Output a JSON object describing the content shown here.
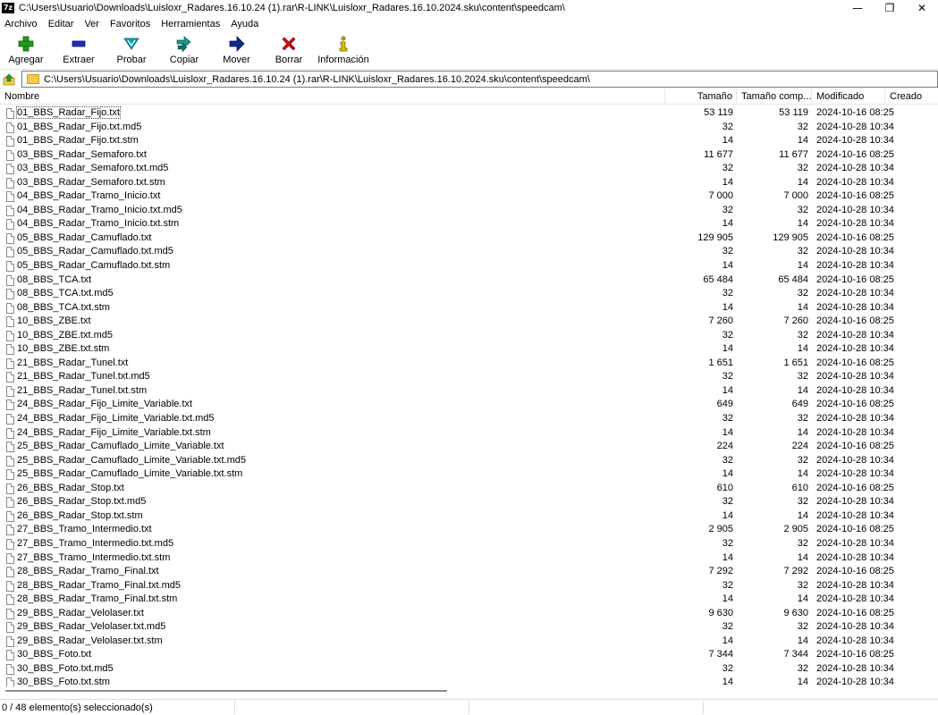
{
  "window": {
    "app_icon": "7z",
    "title": "C:\\Users\\Usuario\\Downloads\\Luisloxr_Radares.16.10.24 (1).rar\\R-LINK\\Luisloxr_Radares.16.10.2024.sku\\content\\speedcam\\",
    "minimize": "—",
    "maximize": "❐",
    "close": "✕"
  },
  "menu": [
    "Archivo",
    "Editar",
    "Ver",
    "Favoritos",
    "Herramientas",
    "Ayuda"
  ],
  "toolbar": [
    {
      "label": "Agregar",
      "icon": "plus-icon",
      "color": "#1f9a1f"
    },
    {
      "label": "Extraer",
      "icon": "minus-icon",
      "color": "#1c2fb8"
    },
    {
      "label": "Probar",
      "icon": "check-icon",
      "color": "#13a3b2"
    },
    {
      "label": "Copiar",
      "icon": "double-arrow-icon",
      "color": "#16998e"
    },
    {
      "label": "Mover",
      "icon": "arrow-right-icon",
      "color": "#0d2a8a"
    },
    {
      "label": "Borrar",
      "icon": "x-icon",
      "color": "#cc1111"
    },
    {
      "label": "Información",
      "icon": "info-icon",
      "color": "#b8a000"
    }
  ],
  "address": {
    "path": "C:\\Users\\Usuario\\Downloads\\Luisloxr_Radares.16.10.24 (1).rar\\R-LINK\\Luisloxr_Radares.16.10.2024.sku\\content\\speedcam\\"
  },
  "columns": {
    "name": "Nombre",
    "size": "Tamaño",
    "packed": "Tamaño comp...",
    "modified": "Modificado",
    "created": "Creado"
  },
  "files": [
    {
      "name": "01_BBS_Radar_Fijo.txt",
      "size": "53 119",
      "packed": "53 119",
      "modified": "2024-10-16 08:25"
    },
    {
      "name": "01_BBS_Radar_Fijo.txt.md5",
      "size": "32",
      "packed": "32",
      "modified": "2024-10-28 10:34"
    },
    {
      "name": "01_BBS_Radar_Fijo.txt.stm",
      "size": "14",
      "packed": "14",
      "modified": "2024-10-28 10:34"
    },
    {
      "name": "03_BBS_Radar_Semaforo.txt",
      "size": "11 677",
      "packed": "11 677",
      "modified": "2024-10-16 08:25"
    },
    {
      "name": "03_BBS_Radar_Semaforo.txt.md5",
      "size": "32",
      "packed": "32",
      "modified": "2024-10-28 10:34"
    },
    {
      "name": "03_BBS_Radar_Semaforo.txt.stm",
      "size": "14",
      "packed": "14",
      "modified": "2024-10-28 10:34"
    },
    {
      "name": "04_BBS_Radar_Tramo_Inicio.txt",
      "size": "7 000",
      "packed": "7 000",
      "modified": "2024-10-16 08:25"
    },
    {
      "name": "04_BBS_Radar_Tramo_Inicio.txt.md5",
      "size": "32",
      "packed": "32",
      "modified": "2024-10-28 10:34"
    },
    {
      "name": "04_BBS_Radar_Tramo_Inicio.txt.stm",
      "size": "14",
      "packed": "14",
      "modified": "2024-10-28 10:34"
    },
    {
      "name": "05_BBS_Radar_Camuflado.txt",
      "size": "129 905",
      "packed": "129 905",
      "modified": "2024-10-16 08:25"
    },
    {
      "name": "05_BBS_Radar_Camuflado.txt.md5",
      "size": "32",
      "packed": "32",
      "modified": "2024-10-28 10:34"
    },
    {
      "name": "05_BBS_Radar_Camuflado.txt.stm",
      "size": "14",
      "packed": "14",
      "modified": "2024-10-28 10:34"
    },
    {
      "name": "08_BBS_TCA.txt",
      "size": "65 484",
      "packed": "65 484",
      "modified": "2024-10-16 08:25"
    },
    {
      "name": "08_BBS_TCA.txt.md5",
      "size": "32",
      "packed": "32",
      "modified": "2024-10-28 10:34"
    },
    {
      "name": "08_BBS_TCA.txt.stm",
      "size": "14",
      "packed": "14",
      "modified": "2024-10-28 10:34"
    },
    {
      "name": "10_BBS_ZBE.txt",
      "size": "7 260",
      "packed": "7 260",
      "modified": "2024-10-16 08:25"
    },
    {
      "name": "10_BBS_ZBE.txt.md5",
      "size": "32",
      "packed": "32",
      "modified": "2024-10-28 10:34"
    },
    {
      "name": "10_BBS_ZBE.txt.stm",
      "size": "14",
      "packed": "14",
      "modified": "2024-10-28 10:34"
    },
    {
      "name": "21_BBS_Radar_Tunel.txt",
      "size": "1 651",
      "packed": "1 651",
      "modified": "2024-10-16 08:25"
    },
    {
      "name": "21_BBS_Radar_Tunel.txt.md5",
      "size": "32",
      "packed": "32",
      "modified": "2024-10-28 10:34"
    },
    {
      "name": "21_BBS_Radar_Tunel.txt.stm",
      "size": "14",
      "packed": "14",
      "modified": "2024-10-28 10:34"
    },
    {
      "name": "24_BBS_Radar_Fijo_Limite_Variable.txt",
      "size": "649",
      "packed": "649",
      "modified": "2024-10-16 08:25"
    },
    {
      "name": "24_BBS_Radar_Fijo_Limite_Variable.txt.md5",
      "size": "32",
      "packed": "32",
      "modified": "2024-10-28 10:34"
    },
    {
      "name": "24_BBS_Radar_Fijo_Limite_Variable.txt.stm",
      "size": "14",
      "packed": "14",
      "modified": "2024-10-28 10:34"
    },
    {
      "name": "25_BBS_Radar_Camuflado_Limite_Variable.txt",
      "size": "224",
      "packed": "224",
      "modified": "2024-10-16 08:25"
    },
    {
      "name": "25_BBS_Radar_Camuflado_Limite_Variable.txt.md5",
      "size": "32",
      "packed": "32",
      "modified": "2024-10-28 10:34"
    },
    {
      "name": "25_BBS_Radar_Camuflado_Limite_Variable.txt.stm",
      "size": "14",
      "packed": "14",
      "modified": "2024-10-28 10:34"
    },
    {
      "name": "26_BBS_Radar_Stop.txt",
      "size": "610",
      "packed": "610",
      "modified": "2024-10-16 08:25"
    },
    {
      "name": "26_BBS_Radar_Stop.txt.md5",
      "size": "32",
      "packed": "32",
      "modified": "2024-10-28 10:34"
    },
    {
      "name": "26_BBS_Radar_Stop.txt.stm",
      "size": "14",
      "packed": "14",
      "modified": "2024-10-28 10:34"
    },
    {
      "name": "27_BBS_Tramo_Intermedio.txt",
      "size": "2 905",
      "packed": "2 905",
      "modified": "2024-10-16 08:25"
    },
    {
      "name": "27_BBS_Tramo_Intermedio.txt.md5",
      "size": "32",
      "packed": "32",
      "modified": "2024-10-28 10:34"
    },
    {
      "name": "27_BBS_Tramo_Intermedio.txt.stm",
      "size": "14",
      "packed": "14",
      "modified": "2024-10-28 10:34"
    },
    {
      "name": "28_BBS_Radar_Tramo_Final.txt",
      "size": "7 292",
      "packed": "7 292",
      "modified": "2024-10-16 08:25"
    },
    {
      "name": "28_BBS_Radar_Tramo_Final.txt.md5",
      "size": "32",
      "packed": "32",
      "modified": "2024-10-28 10:34"
    },
    {
      "name": "28_BBS_Radar_Tramo_Final.txt.stm",
      "size": "14",
      "packed": "14",
      "modified": "2024-10-28 10:34"
    },
    {
      "name": "29_BBS_Radar_Velolaser.txt",
      "size": "9 630",
      "packed": "9 630",
      "modified": "2024-10-16 08:25"
    },
    {
      "name": "29_BBS_Radar_Velolaser.txt.md5",
      "size": "32",
      "packed": "32",
      "modified": "2024-10-28 10:34"
    },
    {
      "name": "29_BBS_Radar_Velolaser.txt.stm",
      "size": "14",
      "packed": "14",
      "modified": "2024-10-28 10:34"
    },
    {
      "name": "30_BBS_Foto.txt",
      "size": "7 344",
      "packed": "7 344",
      "modified": "2024-10-16 08:25"
    },
    {
      "name": "30_BBS_Foto.txt.md5",
      "size": "32",
      "packed": "32",
      "modified": "2024-10-28 10:34"
    },
    {
      "name": "30_BBS_Foto.txt.stm",
      "size": "14",
      "packed": "14",
      "modified": "2024-10-28 10:34"
    }
  ],
  "status": {
    "selection": "0 / 48 elemento(s) seleccionado(s)"
  }
}
